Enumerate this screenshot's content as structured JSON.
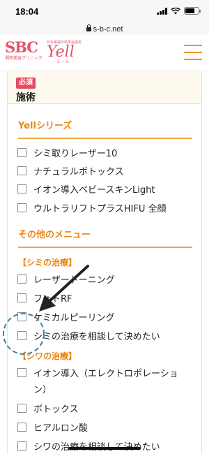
{
  "status_bar": {
    "time": "18:04"
  },
  "browser": {
    "url": "s-b-c.net"
  },
  "header": {
    "logo_sbc": "SBC",
    "logo_sbc_sub": "湘南美容クリニック",
    "logo_yell_tag": "日本美容外科学会認定",
    "logo_yell": "Yell",
    "logo_yell_sub": "エ ー ル",
    "menu_icon": "hamburger-menu-icon"
  },
  "form": {
    "required_badge": "必須",
    "field_title": "施術"
  },
  "sections": {
    "yell_series_title": "Yellシリーズ",
    "yell_series": [
      "シミ取りレーザー10",
      "ナチュラルボトックス",
      "イオン導入ベビースキンLight",
      "ウルトラリフトプラスHIFU 全顔"
    ],
    "other_menu_title": "その他のメニュー",
    "spots_title": "【シミの治療】",
    "spots": [
      "レーザートーニング",
      "フォトRF",
      "ケミカルピーリング",
      "シミの治療を相談して決めたい"
    ],
    "wrinkles_title": "【シワの治療】",
    "wrinkles": [
      "イオン導入（エレクトロポレーショ",
      "ン）",
      "ボトックス",
      "ヒアルロン酸",
      "シワの治療を相談して決めたい"
    ]
  },
  "annotation": {
    "arrow_color": "#222222",
    "circle_color": "#3c7fa8"
  },
  "colors": {
    "accent_orange": "#e8860f",
    "brand_pink": "#e0546b",
    "required_red": "#e14c63"
  }
}
